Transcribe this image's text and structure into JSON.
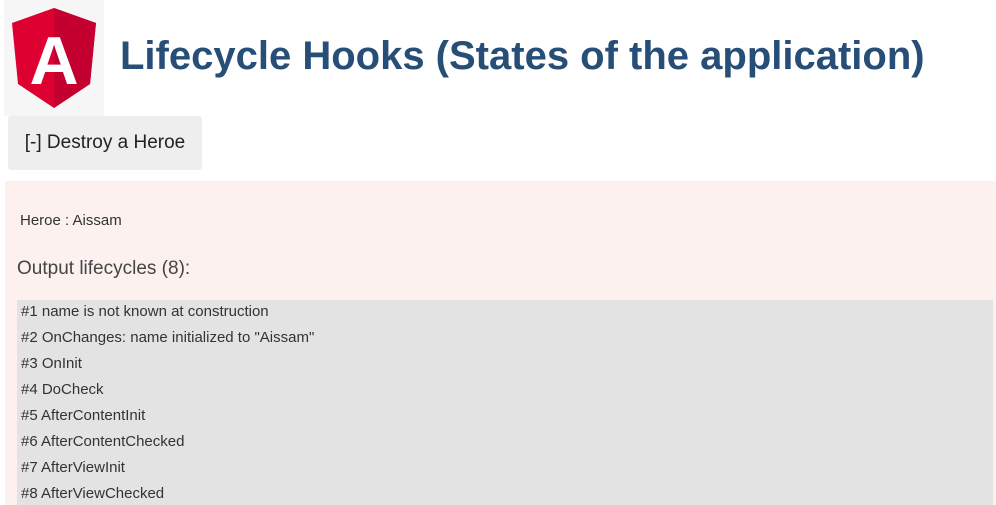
{
  "header": {
    "title": "Lifecycle Hooks (States of the application)",
    "logo_icon": "angular-logo-icon",
    "logo_letter": "A",
    "logo_colors": {
      "dark": "#b52e31",
      "light": "#dd0031",
      "letter": "#ffffff"
    },
    "title_color": "#264e77"
  },
  "toolbar": {
    "destroy_label": "[-] Destroy a Heroe"
  },
  "panel": {
    "hero_text": "Heroe : Aissam",
    "output_title": "Output lifecycles (8):",
    "log": [
      "#1 name is not known at construction",
      "#2 OnChanges: name initialized to \"Aissam\"",
      "#3 OnInit",
      "#4 DoCheck",
      "#5 AfterContentInit",
      "#6 AfterContentChecked",
      "#7 AfterViewInit",
      "#8 AfterViewChecked"
    ],
    "background": "#fdf1f0",
    "log_background": "#e3e3e3"
  }
}
